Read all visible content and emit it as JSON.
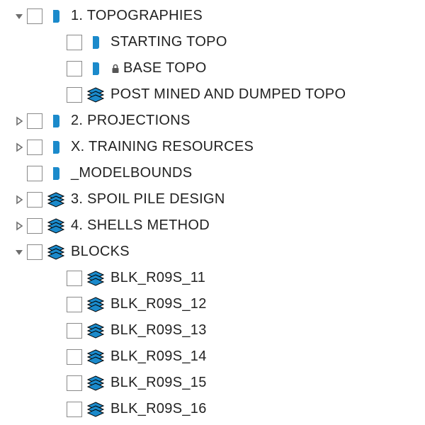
{
  "tree": [
    {
      "depth": 0,
      "expander": "open",
      "icon": "design-folder",
      "locked": false,
      "label": "1. TOPOGRAPHIES"
    },
    {
      "depth": 1,
      "expander": "none",
      "icon": "design-folder",
      "locked": false,
      "label": "STARTING TOPO"
    },
    {
      "depth": 1,
      "expander": "none",
      "icon": "design-folder",
      "locked": true,
      "label": "BASE TOPO"
    },
    {
      "depth": 1,
      "expander": "none",
      "icon": "layers-stack",
      "locked": false,
      "label": "POST MINED AND DUMPED TOPO"
    },
    {
      "depth": 0,
      "expander": "closed",
      "icon": "design-folder",
      "locked": false,
      "label": "2. PROJECTIONS"
    },
    {
      "depth": 0,
      "expander": "closed",
      "icon": "design-folder",
      "locked": false,
      "label": "X. TRAINING RESOURCES"
    },
    {
      "depth": 0,
      "expander": "none",
      "icon": "design-folder",
      "locked": false,
      "label": "_MODELBOUNDS"
    },
    {
      "depth": 0,
      "expander": "closed",
      "icon": "layers-stack",
      "locked": false,
      "label": "3. SPOIL PILE DESIGN"
    },
    {
      "depth": 0,
      "expander": "closed",
      "icon": "layers-stack",
      "locked": false,
      "label": "4. SHELLS METHOD"
    },
    {
      "depth": 0,
      "expander": "open",
      "icon": "layers-stack",
      "locked": false,
      "label": "BLOCKS"
    },
    {
      "depth": 1,
      "expander": "none",
      "icon": "layers-stack",
      "locked": false,
      "label": "BLK_R09S_11"
    },
    {
      "depth": 1,
      "expander": "none",
      "icon": "layers-stack",
      "locked": false,
      "label": "BLK_R09S_12"
    },
    {
      "depth": 1,
      "expander": "none",
      "icon": "layers-stack",
      "locked": false,
      "label": "BLK_R09S_13"
    },
    {
      "depth": 1,
      "expander": "none",
      "icon": "layers-stack",
      "locked": false,
      "label": "BLK_R09S_14"
    },
    {
      "depth": 1,
      "expander": "none",
      "icon": "layers-stack",
      "locked": false,
      "label": "BLK_R09S_15"
    },
    {
      "depth": 1,
      "expander": "none",
      "icon": "layers-stack",
      "locked": false,
      "label": "BLK_R09S_16"
    }
  ],
  "colors": {
    "expander": "#6e6e6e",
    "iconBlue": "#1b8acb",
    "iconBlueDark": "#0f6aa0",
    "lock": "#555"
  },
  "layout": {
    "baseIndent": 18,
    "levelIndent": 56
  }
}
